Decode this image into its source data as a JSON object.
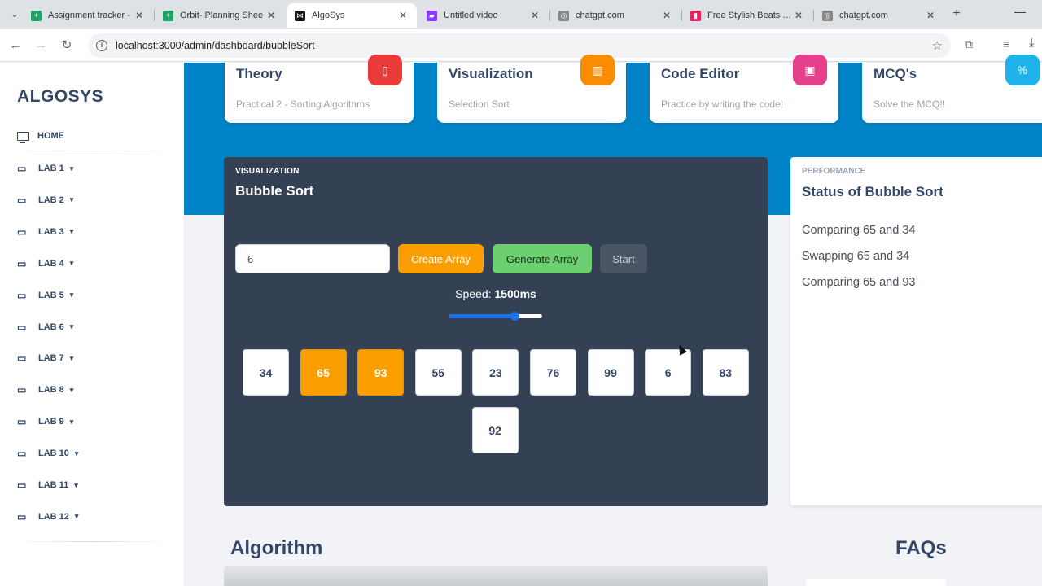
{
  "browser": {
    "tabs": [
      {
        "title": "Assignment tracker -",
        "favicon_color": "#1fa463",
        "favicon_glyph": "+"
      },
      {
        "title": "Orbit- Planning Shee",
        "favicon_color": "#1fa463",
        "favicon_glyph": "+"
      },
      {
        "title": "AlgoSys",
        "favicon_color": "#111111",
        "favicon_glyph": "⋈",
        "active": true
      },
      {
        "title": "Untitled video",
        "favicon_color": "#8b3dff",
        "favicon_glyph": "▰"
      },
      {
        "title": "chatgpt.com",
        "favicon_color": "#888888",
        "favicon_glyph": "◎"
      },
      {
        "title": "Free Stylish Beats • L",
        "favicon_color": "#e0245e",
        "favicon_glyph": "▮"
      },
      {
        "title": "chatgpt.com",
        "favicon_color": "#888888",
        "favicon_glyph": "◎"
      }
    ],
    "tab_close_glyph": "✕",
    "new_tab_glyph": "+",
    "url": "localhost:3000/admin/dashboard/bubbleSort"
  },
  "sidebar": {
    "brand": "ALGOSYS",
    "home_label": "HOME",
    "labs": [
      "LAB 1",
      "LAB 2",
      "LAB 3",
      "LAB 4",
      "LAB 5",
      "LAB 6",
      "LAB 7",
      "LAB 8",
      "LAB 9",
      "LAB 10",
      "LAB 11",
      "LAB 12"
    ]
  },
  "cards": [
    {
      "title": "Theory",
      "subtitle": "Practical 2 - Sorting Algorithms",
      "color": "#ea3a3a",
      "icon": "document-icon",
      "glyph": "▯"
    },
    {
      "title": "Visualization",
      "subtitle": "Selection Sort",
      "color": "#fb8c00",
      "icon": "chart-icon",
      "glyph": "▥"
    },
    {
      "title": "Code Editor",
      "subtitle": "Practice by writing the code!",
      "color": "#e6408c",
      "icon": "laptop-icon",
      "glyph": "▣"
    },
    {
      "title": "MCQ's",
      "subtitle": "Solve the MCQ!!",
      "color": "#1eb3ea",
      "icon": "percent-icon",
      "glyph": "%"
    }
  ],
  "visualization": {
    "label": "VISUALIZATION",
    "title": "Bubble Sort",
    "input_value": "6",
    "create_label": "Create Array",
    "generate_label": "Generate Array",
    "start_label": "Start",
    "speed_prefix": "Speed:",
    "speed_value": "1500ms",
    "speed_level": 0.7,
    "array": [
      34,
      65,
      93,
      55,
      23,
      76,
      99,
      6,
      83,
      92
    ],
    "highlighted": [
      1,
      2
    ]
  },
  "performance": {
    "label": "PERFORMANCE",
    "title": "Status of Bubble Sort",
    "log": [
      "Comparing 65 and 34",
      "Swapping 65 and 34",
      "Comparing 65 and 93"
    ]
  },
  "sections": {
    "algorithm": "Algorithm",
    "faqs": "FAQs"
  }
}
